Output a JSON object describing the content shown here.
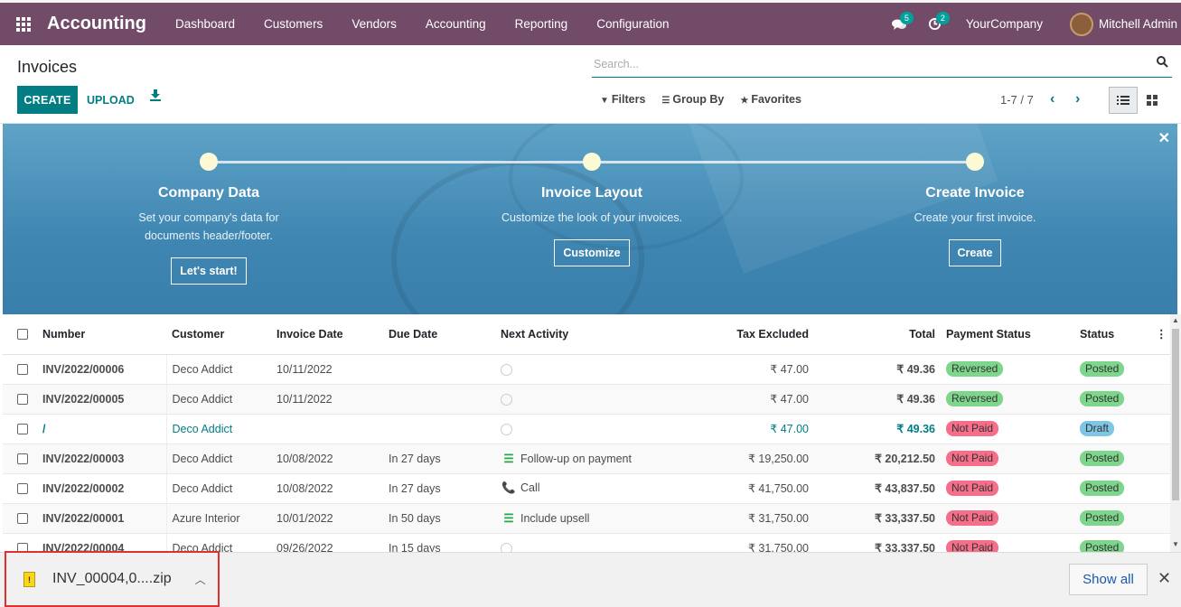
{
  "topbar": {
    "brand": "Accounting",
    "menu": [
      "Dashboard",
      "Customers",
      "Vendors",
      "Accounting",
      "Reporting",
      "Configuration"
    ],
    "messages_count": "5",
    "activities_count": "2",
    "company": "YourCompany",
    "user": "Mitchell Admin"
  },
  "control": {
    "title": "Invoices",
    "create_label": "CREATE",
    "upload_label": "UPLOAD",
    "search_placeholder": "Search...",
    "filters_label": "Filters",
    "groupby_label": "Group By",
    "favorites_label": "Favorites",
    "pager": "1-7 / 7"
  },
  "banner": {
    "steps": [
      {
        "title": "Company Data",
        "desc1": "Set your company's data for",
        "desc2": "documents header/footer.",
        "button": "Let's start!"
      },
      {
        "title": "Invoice Layout",
        "desc1": "Customize the look of your invoices.",
        "desc2": "",
        "button": "Customize"
      },
      {
        "title": "Create Invoice",
        "desc1": "Create your first invoice.",
        "desc2": "",
        "button": "Create"
      }
    ]
  },
  "table": {
    "headers": {
      "number": "Number",
      "customer": "Customer",
      "invoice_date": "Invoice Date",
      "due_date": "Due Date",
      "next_activity": "Next Activity",
      "tax_excluded": "Tax Excluded",
      "total": "Total",
      "payment_status": "Payment Status",
      "status": "Status"
    },
    "rows": [
      {
        "number": "INV/2022/00006",
        "customer": "Deco Addict",
        "invoice_date": "10/11/2022",
        "due_date": "",
        "activity": "",
        "tax_excluded": "₹ 47.00",
        "total": "₹ 49.36",
        "payment_status": "Reversed",
        "status": "Posted"
      },
      {
        "number": "INV/2022/00005",
        "customer": "Deco Addict",
        "invoice_date": "10/11/2022",
        "due_date": "",
        "activity": "",
        "tax_excluded": "₹ 47.00",
        "total": "₹ 49.36",
        "payment_status": "Reversed",
        "status": "Posted"
      },
      {
        "number": "/",
        "customer": "Deco Addict",
        "invoice_date": "",
        "due_date": "",
        "activity": "",
        "tax_excluded": "₹ 47.00",
        "total": "₹ 49.36",
        "payment_status": "Not Paid",
        "status": "Draft"
      },
      {
        "number": "INV/2022/00003",
        "customer": "Deco Addict",
        "invoice_date": "10/08/2022",
        "due_date": "In 27 days",
        "activity": "Follow-up on payment",
        "tax_excluded": "₹ 19,250.00",
        "total": "₹ 20,212.50",
        "payment_status": "Not Paid",
        "status": "Posted"
      },
      {
        "number": "INV/2022/00002",
        "customer": "Deco Addict",
        "invoice_date": "10/08/2022",
        "due_date": "In 27 days",
        "activity": "Call",
        "tax_excluded": "₹ 41,750.00",
        "total": "₹ 43,837.50",
        "payment_status": "Not Paid",
        "status": "Posted"
      },
      {
        "number": "INV/2022/00001",
        "customer": "Azure Interior",
        "invoice_date": "10/01/2022",
        "due_date": "In 50 days",
        "activity": "Include upsell",
        "tax_excluded": "₹ 31,750.00",
        "total": "₹ 33,337.50",
        "payment_status": "Not Paid",
        "status": "Posted"
      },
      {
        "number": "INV/2022/00004",
        "customer": "Deco Addict",
        "invoice_date": "09/26/2022",
        "due_date": "In 15 days",
        "activity": "",
        "tax_excluded": "₹ 31,750.00",
        "total": "₹ 33,337.50",
        "payment_status": "Not Paid",
        "status": "Posted"
      }
    ]
  },
  "downloads": {
    "file_name": "INV_00004,0....zip",
    "show_all": "Show all"
  },
  "colors": {
    "nav": "#714B67",
    "accent": "#017E84",
    "reversed": "#7ed58c",
    "not_paid": "#f56f8a",
    "draft": "#7ec6e4"
  }
}
